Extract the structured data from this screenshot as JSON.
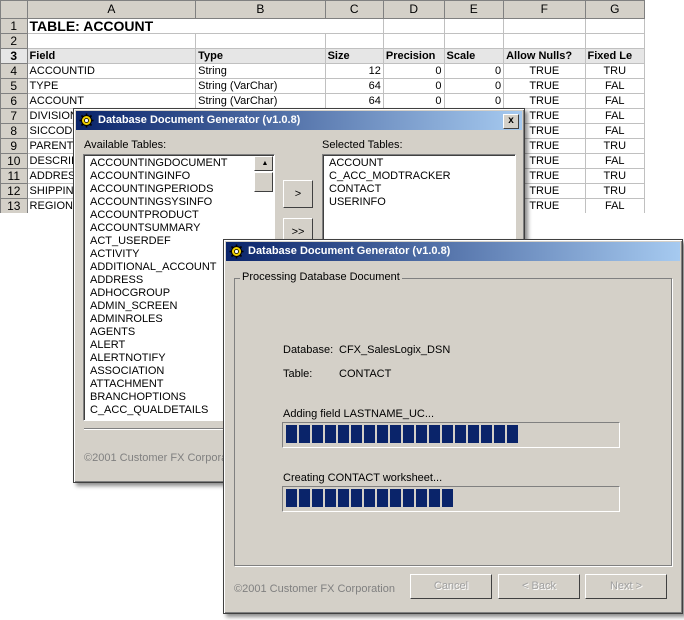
{
  "spreadsheet": {
    "columns": [
      "A",
      "B",
      "C",
      "D",
      "E",
      "F",
      "G"
    ],
    "row_numbers": [
      "1",
      "2",
      "3",
      "4",
      "5",
      "6",
      "7",
      "8",
      "9",
      "10",
      "11",
      "12",
      "13"
    ],
    "title": "TABLE: ACCOUNT",
    "headers": [
      "Field",
      "Type",
      "Size",
      "Precision",
      "Scale",
      "Allow Nulls?",
      "Fixed Le"
    ],
    "rows": [
      [
        "ACCOUNTID",
        "String",
        "12",
        "0",
        "0",
        "TRUE",
        "TRU"
      ],
      [
        "TYPE",
        "String (VarChar)",
        "64",
        "0",
        "0",
        "TRUE",
        "FAL"
      ],
      [
        "ACCOUNT",
        "String (VarChar)",
        "64",
        "0",
        "0",
        "TRUE",
        "FAL"
      ],
      [
        "DIVISION",
        "",
        "",
        "",
        "",
        "TRUE",
        "FAL"
      ],
      [
        "SICCODE",
        "",
        "",
        "",
        "",
        "TRUE",
        "FAL"
      ],
      [
        "PARENT",
        "",
        "",
        "",
        "",
        "TRUE",
        "TRU"
      ],
      [
        "DESCRIP",
        "",
        "",
        "",
        "",
        "TRUE",
        "FAL"
      ],
      [
        "ADDRES",
        "",
        "",
        "",
        "",
        "TRUE",
        "TRU"
      ],
      [
        "SHIPPIN",
        "",
        "",
        "",
        "",
        "TRUE",
        "TRU"
      ],
      [
        "REGION",
        "",
        "",
        "",
        "",
        "TRUE",
        "FAL"
      ]
    ]
  },
  "dialog1": {
    "title": "Database Document Generator (v1.0.8)",
    "close_label": "x",
    "available_label": "Available Tables:",
    "selected_label": "Selected Tables:",
    "available_tables": [
      "ACCOUNTINGDOCUMENT",
      "ACCOUNTINGINFO",
      "ACCOUNTINGPERIODS",
      "ACCOUNTINGSYSINFO",
      "ACCOUNTPRODUCT",
      "ACCOUNTSUMMARY",
      "ACT_USERDEF",
      "ACTIVITY",
      "ADDITIONAL_ACCOUNT",
      "ADDRESS",
      "ADHOCGROUP",
      "ADMIN_SCREEN",
      "ADMINROLES",
      "AGENTS",
      "ALERT",
      "ALERTNOTIFY",
      "ASSOCIATION",
      "ATTACHMENT",
      "BRANCHOPTIONS",
      "C_ACC_QUALDETAILS"
    ],
    "selected_tables": [
      "ACCOUNT",
      "C_ACC_MODTRACKER",
      "CONTACT",
      "USERINFO"
    ],
    "add_button": ">",
    "add_all_button": ">>",
    "footer": "©2001 Customer FX Corporation"
  },
  "dialog2": {
    "title": "Database Document Generator (v1.0.8)",
    "group_label": "Processing Database Document",
    "database_label": "Database:",
    "database_value": "CFX_SalesLogix_DSN",
    "table_label": "Table:",
    "table_value": "CONTACT",
    "status1": "Adding field LASTNAME_UC...",
    "progress1": 0.72,
    "status2": "Creating CONTACT worksheet...",
    "progress2": 0.5,
    "footer": "©2001 Customer FX Corporation",
    "cancel_button": "Cancel",
    "back_button": "< Back",
    "next_button": "Next >"
  },
  "colors": {
    "titlebar_start": "#0a246a",
    "titlebar_end": "#a6caf0",
    "progress_fill": "#0a246a",
    "window_face": "#d4d0c8"
  }
}
